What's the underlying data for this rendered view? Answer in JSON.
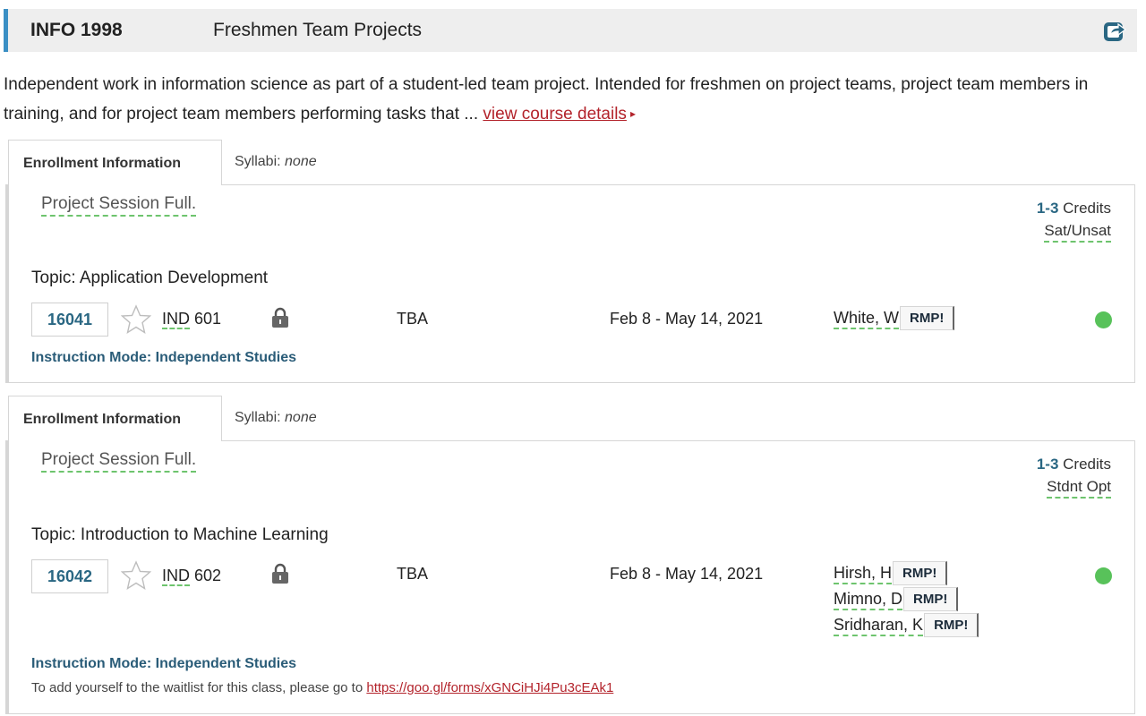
{
  "header": {
    "course_code": "INFO 1998",
    "course_title": "Freshmen Team Projects",
    "share_icon": "share-icon"
  },
  "description": {
    "text": "Independent work in information science as part of a student-led team project. Intended for freshmen on project teams, project team members in training, and for project team members performing tasks that ... ",
    "link_label": "view course details",
    "arrow": "▸"
  },
  "colors": {
    "accent": "#3b8fc4",
    "link": "#b3232b",
    "class_number": "#2a6783",
    "open_status": "#58c25a"
  },
  "sections": [
    {
      "tab_enrollment": "Enrollment Information",
      "tab_syllabi_prefix": "Syllabi: ",
      "tab_syllabi_value": "none",
      "status_note": "Project Session Full.",
      "credits_value": "1-3",
      "credits_label": " Credits",
      "grading": "Sat/Unsat",
      "topic": "Topic: Application Development",
      "class_number": "16041",
      "component_type": "IND",
      "section_number": " 601",
      "time": "TBA",
      "dates": "Feb 8 - May 14, 2021",
      "instructors": [
        {
          "name": "White, W",
          "rmp": "RMP!"
        }
      ],
      "instruction_mode": "Instruction Mode: Independent Studies",
      "open_status": "open"
    },
    {
      "tab_enrollment": "Enrollment Information",
      "tab_syllabi_prefix": "Syllabi: ",
      "tab_syllabi_value": "none",
      "status_note": "Project Session Full.",
      "credits_value": "1-3",
      "credits_label": " Credits",
      "grading": "Stdnt Opt",
      "topic": "Topic: Introduction to Machine Learning",
      "class_number": "16042",
      "component_type": "IND",
      "section_number": " 602",
      "time": "TBA",
      "dates": "Feb 8 - May 14, 2021",
      "instructors": [
        {
          "name": "Hirsh, H",
          "rmp": "RMP!"
        },
        {
          "name": "Mimno, D",
          "rmp": "RMP!"
        },
        {
          "name": "Sridharan, K",
          "rmp": "RMP!"
        }
      ],
      "instruction_mode": "Instruction Mode: Independent Studies",
      "waitlist_text": "To add yourself to the waitlist for this class, please go to ",
      "waitlist_url": "https://goo.gl/forms/xGNCiHJi4Pu3cEAk1",
      "open_status": "open"
    }
  ]
}
